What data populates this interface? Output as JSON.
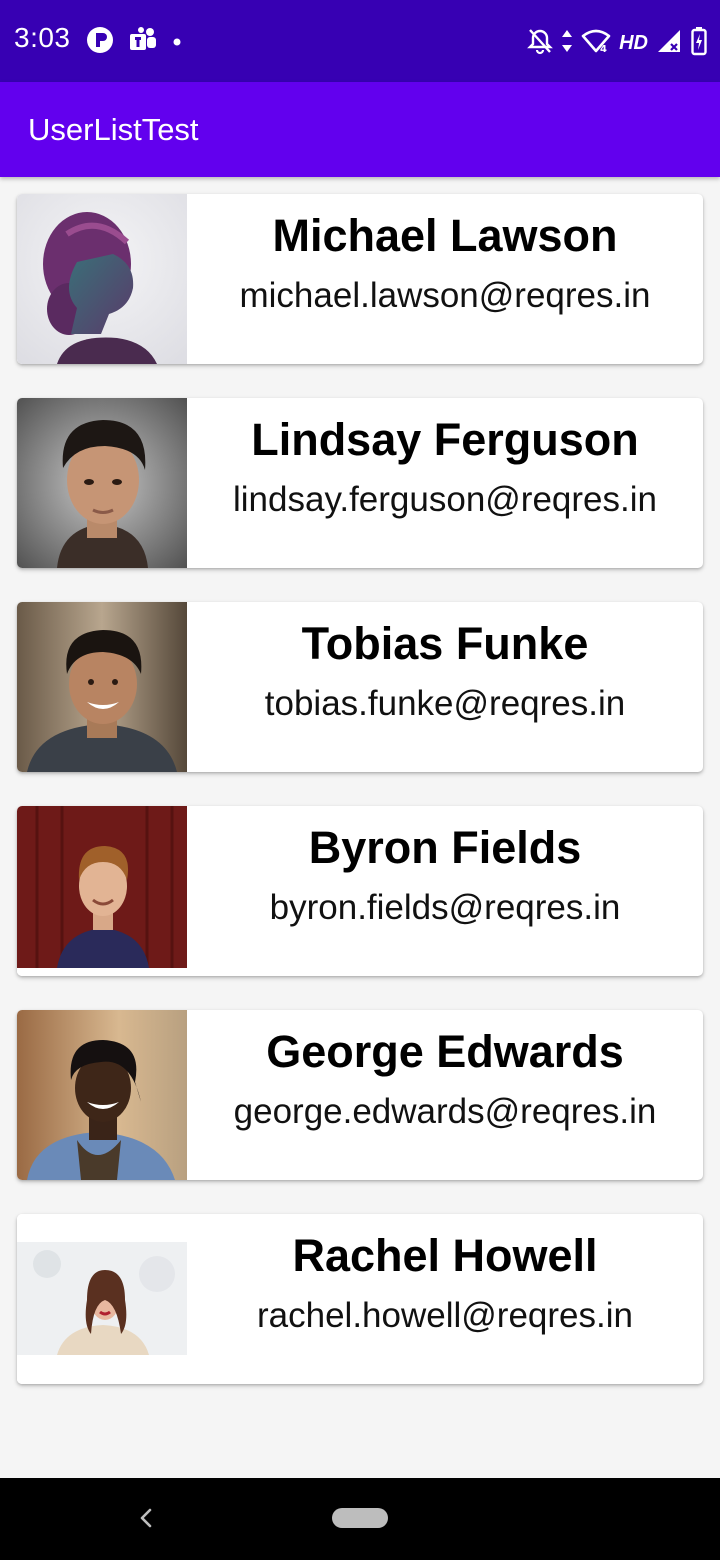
{
  "status_bar": {
    "time": "3:03",
    "network_label": "HD",
    "left_icons": [
      "app-notification-icon",
      "teams-icon",
      "dot-icon"
    ],
    "right_icons": [
      "mute-bell-icon",
      "data-arrows-icon",
      "wifi-icon",
      "signal-icon",
      "battery-charging-icon"
    ]
  },
  "app_bar": {
    "title": "UserListTest"
  },
  "users": [
    {
      "name": "Michael Lawson",
      "email": "michael.lawson@reqres.in"
    },
    {
      "name": "Lindsay Ferguson",
      "email": "lindsay.ferguson@reqres.in"
    },
    {
      "name": "Tobias Funke",
      "email": "tobias.funke@reqres.in"
    },
    {
      "name": "Byron Fields",
      "email": "byron.fields@reqres.in"
    },
    {
      "name": "George Edwards",
      "email": "george.edwards@reqres.in"
    },
    {
      "name": "Rachel Howell",
      "email": "rachel.howell@reqres.in"
    }
  ],
  "nav_bar": {
    "icons": [
      "back-icon",
      "home-pill-icon"
    ]
  },
  "colors": {
    "status_bar": "#3700b3",
    "app_bar": "#6200ee",
    "background": "#f5f5f5",
    "card": "#ffffff"
  }
}
